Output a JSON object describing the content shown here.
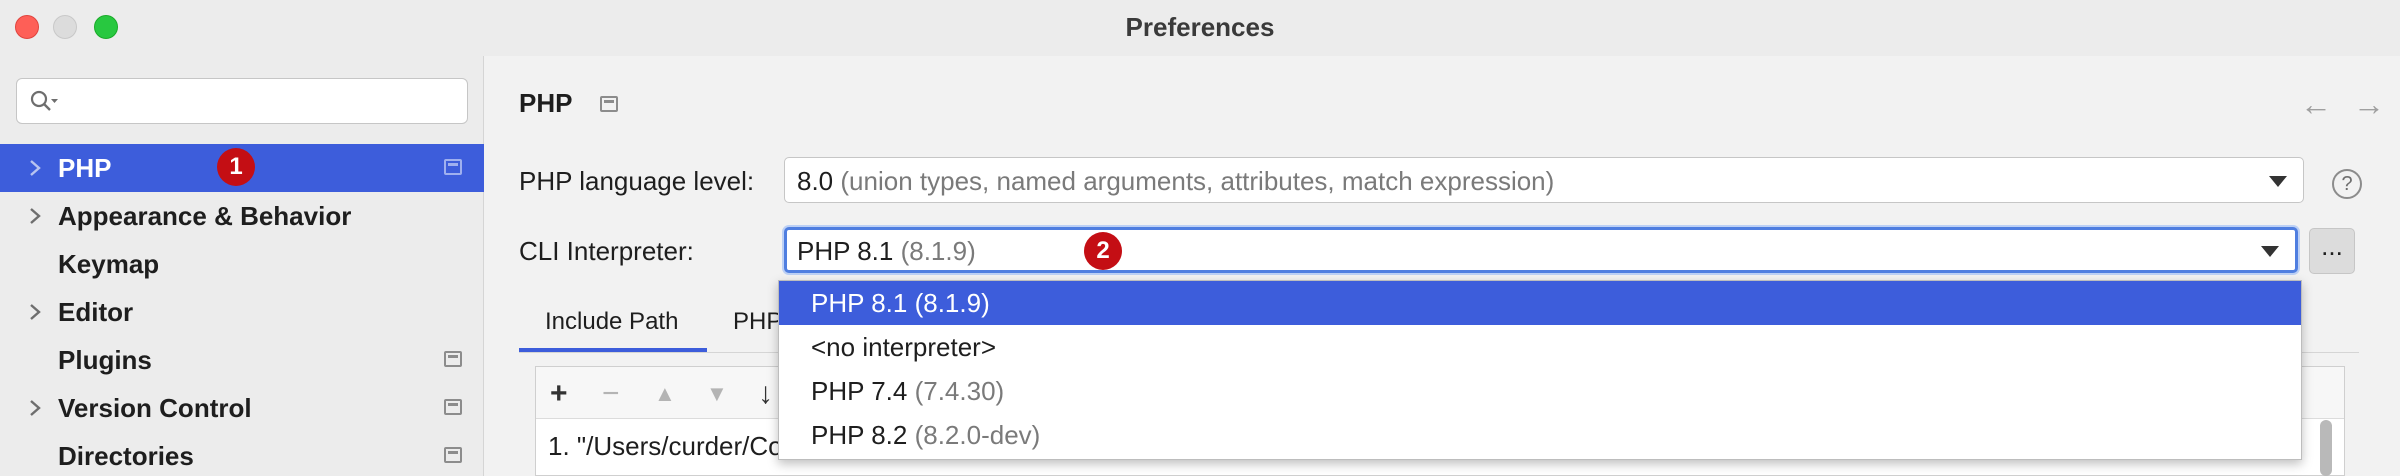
{
  "window": {
    "title": "Preferences",
    "traffic_colors": {
      "close": "#fe5f57",
      "minimize": "#dcdcdc",
      "maximize": "#28c840"
    }
  },
  "sidebar": {
    "search": {
      "value": "",
      "placeholder": ""
    },
    "items": [
      {
        "label": "PHP",
        "has_chevron": true,
        "selected": true,
        "project_icon": true
      },
      {
        "label": "Appearance & Behavior",
        "has_chevron": true,
        "selected": false,
        "project_icon": false
      },
      {
        "label": "Keymap",
        "has_chevron": false,
        "selected": false,
        "project_icon": false
      },
      {
        "label": "Editor",
        "has_chevron": true,
        "selected": false,
        "project_icon": false
      },
      {
        "label": "Plugins",
        "has_chevron": false,
        "selected": false,
        "project_icon": true
      },
      {
        "label": "Version Control",
        "has_chevron": true,
        "selected": false,
        "project_icon": true
      },
      {
        "label": "Directories",
        "has_chevron": false,
        "selected": false,
        "project_icon": true
      }
    ],
    "selection_color": "#3d5ddb"
  },
  "annotations": {
    "badge1": "1",
    "badge2": "2",
    "badge_color": "#c40e14"
  },
  "main": {
    "title": "PHP",
    "back_arrow": "←",
    "forward_arrow": "→",
    "language_level": {
      "label": "PHP language level:",
      "value": "8.0",
      "detail": "(union types, named arguments, attributes, match expression)"
    },
    "help_icon": "?",
    "cli": {
      "label": "CLI Interpreter:",
      "value": "PHP 8.1",
      "detail": "(8.1.9)",
      "browse_label": "..."
    },
    "tabs": [
      {
        "label": "Include Path",
        "active": true
      },
      {
        "label": "PHP",
        "active": false
      }
    ],
    "include_paths": [
      "1. \"/Users/curder/Co"
    ],
    "toolbar": {
      "add": "+",
      "remove": "−",
      "up": "▲",
      "down": "▼",
      "sort": "↓"
    }
  },
  "dropdown": {
    "options": [
      {
        "name": "PHP 8.1",
        "version": "(8.1.9)",
        "selected": true
      },
      {
        "name": "<no interpreter>",
        "version": "",
        "selected": false
      },
      {
        "name": "PHP 7.4",
        "version": "(7.4.30)",
        "selected": false
      },
      {
        "name": "PHP 8.2",
        "version": "(8.2.0-dev)",
        "selected": false
      }
    ]
  }
}
